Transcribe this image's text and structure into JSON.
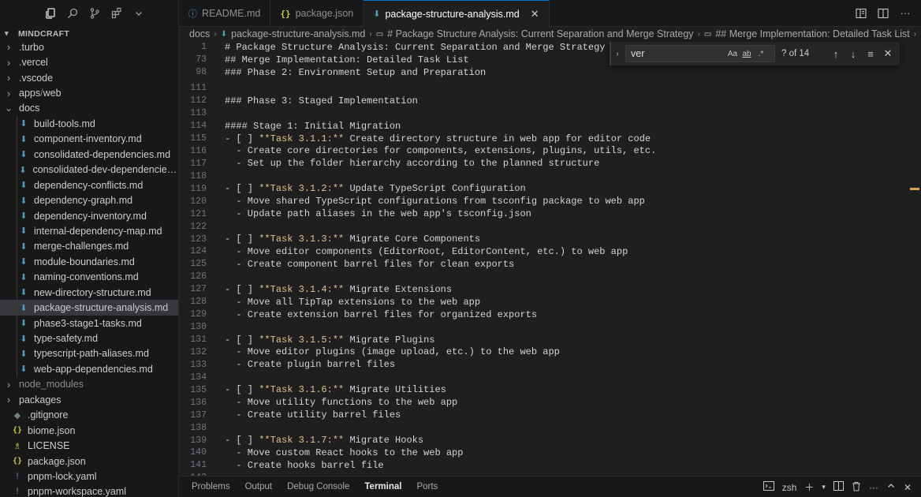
{
  "activity": {
    "icons": [
      "copy-files-icon",
      "search-icon",
      "source-control-icon",
      "extensions-icon",
      "chevron-down-icon"
    ]
  },
  "explorer": {
    "root_label": "MINDCRAFT",
    "items": [
      {
        "label": ".turbo",
        "type": "folder",
        "expanded": false,
        "indent": 1
      },
      {
        "label": ".vercel",
        "type": "folder",
        "expanded": false,
        "indent": 1
      },
      {
        "label": ".vscode",
        "type": "folder",
        "expanded": false,
        "indent": 1
      },
      {
        "label": "apps",
        "label2": "web",
        "type": "folder",
        "expanded": false,
        "indent": 1
      },
      {
        "label": "docs",
        "type": "folder",
        "expanded": true,
        "indent": 1
      },
      {
        "label": "build-tools.md",
        "type": "md",
        "indent": 2
      },
      {
        "label": "component-inventory.md",
        "type": "md",
        "indent": 2
      },
      {
        "label": "consolidated-dependencies.md",
        "type": "md",
        "indent": 2
      },
      {
        "label": "consolidated-dev-dependencies.md",
        "type": "md",
        "indent": 2
      },
      {
        "label": "dependency-conflicts.md",
        "type": "md",
        "indent": 2
      },
      {
        "label": "dependency-graph.md",
        "type": "md",
        "indent": 2
      },
      {
        "label": "dependency-inventory.md",
        "type": "md",
        "indent": 2
      },
      {
        "label": "internal-dependency-map.md",
        "type": "md",
        "indent": 2
      },
      {
        "label": "merge-challenges.md",
        "type": "md",
        "indent": 2
      },
      {
        "label": "module-boundaries.md",
        "type": "md",
        "indent": 2
      },
      {
        "label": "naming-conventions.md",
        "type": "md",
        "indent": 2
      },
      {
        "label": "new-directory-structure.md",
        "type": "md",
        "indent": 2
      },
      {
        "label": "package-structure-analysis.md",
        "type": "md",
        "indent": 2,
        "selected": true
      },
      {
        "label": "phase3-stage1-tasks.md",
        "type": "md",
        "indent": 2
      },
      {
        "label": "type-safety.md",
        "type": "md",
        "indent": 2
      },
      {
        "label": "typescript-path-aliases.md",
        "type": "md",
        "indent": 2
      },
      {
        "label": "web-app-dependencies.md",
        "type": "md",
        "indent": 2
      },
      {
        "label": "node_modules",
        "type": "folder",
        "expanded": false,
        "indent": 1,
        "dim": true
      },
      {
        "label": "packages",
        "type": "folder",
        "expanded": false,
        "indent": 1
      },
      {
        "label": ".gitignore",
        "type": "git",
        "indent": 1
      },
      {
        "label": "biome.json",
        "type": "json",
        "indent": 1
      },
      {
        "label": "LICENSE",
        "type": "license",
        "indent": 1
      },
      {
        "label": "package.json",
        "type": "json",
        "indent": 1
      },
      {
        "label": "pnpm-lock.yaml",
        "type": "yaml",
        "indent": 1
      },
      {
        "label": "pnpm-workspace.yaml",
        "type": "yaml",
        "indent": 1
      }
    ]
  },
  "tabs": [
    {
      "label": "README.md",
      "icon": "info-icon",
      "active": false
    },
    {
      "label": "package.json",
      "icon": "json-icon",
      "active": false
    },
    {
      "label": "package-structure-analysis.md",
      "icon": "markdown-icon",
      "active": true
    }
  ],
  "breadcrumb": [
    "docs",
    "package-structure-analysis.md",
    "# Package Structure Analysis: Current Separation and Merge Strategy",
    "## Merge Implementation: Detailed Task List"
  ],
  "find": {
    "value": "ver",
    "match_case": "Aa",
    "whole_word": "ab",
    "regex": ".*",
    "count": "? of 14"
  },
  "sticky_lines": [
    {
      "num": "1",
      "text": "# Package Structure Analysis: Current Separation and Merge Strategy"
    },
    {
      "num": "73",
      "text": "## Merge Implementation: Detailed Task List"
    },
    {
      "num": "98",
      "text": "### Phase 2: Environment Setup and Preparation"
    }
  ],
  "lines": [
    {
      "num": "111",
      "text": ""
    },
    {
      "num": "112",
      "text": "### Phase 3: Staged Implementation"
    },
    {
      "num": "113",
      "text": ""
    },
    {
      "num": "114",
      "text": "#### Stage 1: Initial Migration"
    },
    {
      "num": "115",
      "pre": "- [ ] ",
      "bold": "**Task 3.1.1:**",
      "text": " Create directory structure in web app for editor code"
    },
    {
      "num": "116",
      "text": "  - Create core directories for components, extensions, plugins, utils, etc."
    },
    {
      "num": "117",
      "text": "  - Set up the folder hierarchy according to the planned structure"
    },
    {
      "num": "118",
      "text": ""
    },
    {
      "num": "119",
      "pre": "- [ ] ",
      "bold": "**Task 3.1.2:**",
      "text": " Update TypeScript Configuration"
    },
    {
      "num": "120",
      "text": "  - Move shared TypeScript configurations from tsconfig package to web app"
    },
    {
      "num": "121",
      "text": "  - Update path aliases in the web app's tsconfig.json"
    },
    {
      "num": "122",
      "text": ""
    },
    {
      "num": "123",
      "pre": "- [ ] ",
      "bold": "**Task 3.1.3:**",
      "text": " Migrate Core Components"
    },
    {
      "num": "124",
      "text": "  - Move editor components (EditorRoot, EditorContent, etc.) to web app"
    },
    {
      "num": "125",
      "text": "  - Create component barrel files for clean exports"
    },
    {
      "num": "126",
      "text": ""
    },
    {
      "num": "127",
      "pre": "- [ ] ",
      "bold": "**Task 3.1.4:**",
      "text": " Migrate Extensions"
    },
    {
      "num": "128",
      "text": "  - Move all TipTap extensions to the web app"
    },
    {
      "num": "129",
      "text": "  - Create extension barrel files for organized exports"
    },
    {
      "num": "130",
      "text": ""
    },
    {
      "num": "131",
      "pre": "- [ ] ",
      "bold": "**Task 3.1.5:**",
      "text": " Migrate Plugins"
    },
    {
      "num": "132",
      "text": "  - Move editor plugins (image upload, etc.) to the web app"
    },
    {
      "num": "133",
      "text": "  - Create plugin barrel files"
    },
    {
      "num": "134",
      "text": ""
    },
    {
      "num": "135",
      "pre": "- [ ] ",
      "bold": "**Task 3.1.6:**",
      "text": " Migrate Utilities"
    },
    {
      "num": "136",
      "text": "  - Move utility functions to the web app"
    },
    {
      "num": "137",
      "text": "  - Create utility barrel files"
    },
    {
      "num": "138",
      "text": ""
    },
    {
      "num": "139",
      "pre": "- [ ] ",
      "bold": "**Task 3.1.7:**",
      "text": " Migrate Hooks"
    },
    {
      "num": "140",
      "text": "  - Move custom React hooks to the web app"
    },
    {
      "num": "141",
      "text": "  - Create hooks barrel file"
    },
    {
      "num": "142",
      "text": ""
    }
  ],
  "panel": {
    "tabs": [
      "Problems",
      "Output",
      "Debug Console",
      "Terminal",
      "Ports"
    ],
    "active": "Terminal",
    "terminal_name": "zsh"
  },
  "colors": {
    "accent": "#0078d4",
    "markdown_icon": "#519aba",
    "json_icon": "#cbcb41",
    "bold_text": "#e2c08d"
  }
}
